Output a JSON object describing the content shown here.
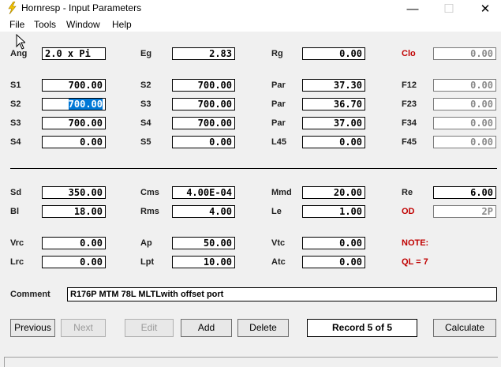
{
  "window": {
    "title": "Hornresp - Input Parameters",
    "minimize": "—",
    "maximize": "☐",
    "close": "✕"
  },
  "menu": [
    "File",
    "Tools",
    "Window",
    "Help"
  ],
  "params": {
    "ang": {
      "label": "Ang",
      "value": "2.0 x Pi"
    },
    "eg": {
      "label": "Eg",
      "value": "2.83"
    },
    "rg": {
      "label": "Rg",
      "value": "0.00"
    },
    "clo": {
      "label": "Clo",
      "value": "0.00"
    },
    "s1": {
      "label": "S1",
      "value": "700.00"
    },
    "s2a": {
      "label": "S2",
      "value": "700.00"
    },
    "par1": {
      "label": "Par",
      "value": "37.30"
    },
    "f12": {
      "label": "F12",
      "value": "0.00"
    },
    "s2b": {
      "label": "S2",
      "value": "700.00"
    },
    "s3a": {
      "label": "S3",
      "value": "700.00"
    },
    "par2": {
      "label": "Par",
      "value": "36.70"
    },
    "f23": {
      "label": "F23",
      "value": "0.00"
    },
    "s3b": {
      "label": "S3",
      "value": "700.00"
    },
    "s4a": {
      "label": "S4",
      "value": "700.00"
    },
    "par3": {
      "label": "Par",
      "value": "37.00"
    },
    "f34": {
      "label": "F34",
      "value": "0.00"
    },
    "s4b": {
      "label": "S4",
      "value": "0.00"
    },
    "s5": {
      "label": "S5",
      "value": "0.00"
    },
    "l45": {
      "label": "L45",
      "value": "0.00"
    },
    "f45": {
      "label": "F45",
      "value": "0.00"
    },
    "sd": {
      "label": "Sd",
      "value": "350.00"
    },
    "cms": {
      "label": "Cms",
      "value": "4.00E-04"
    },
    "mmd": {
      "label": "Mmd",
      "value": "20.00"
    },
    "re": {
      "label": "Re",
      "value": "6.00"
    },
    "bl": {
      "label": "Bl",
      "value": "18.00"
    },
    "rms": {
      "label": "Rms",
      "value": "4.00"
    },
    "le": {
      "label": "Le",
      "value": "1.00"
    },
    "od": {
      "label": "OD",
      "value": "2P"
    },
    "vrc": {
      "label": "Vrc",
      "value": "0.00"
    },
    "ap": {
      "label": "Ap",
      "value": "50.00"
    },
    "vtc": {
      "label": "Vtc",
      "value": "0.00"
    },
    "note": {
      "label": "NOTE:"
    },
    "lrc": {
      "label": "Lrc",
      "value": "0.00"
    },
    "lpt": {
      "label": "Lpt",
      "value": "10.00"
    },
    "atc": {
      "label": "Atc",
      "value": "0.00"
    },
    "ql": {
      "label": "QL = 7"
    }
  },
  "comment": {
    "label": "Comment",
    "value": "R176P MTM 78L MLTLwith offset port"
  },
  "buttons": {
    "previous": "Previous",
    "next": "Next",
    "edit": "Edit",
    "add": "Add",
    "delete": "Delete",
    "calculate": "Calculate"
  },
  "record": "Record 5 of 5",
  "colors": {
    "accent_red": "#c00000",
    "selection": "#0078d7"
  }
}
